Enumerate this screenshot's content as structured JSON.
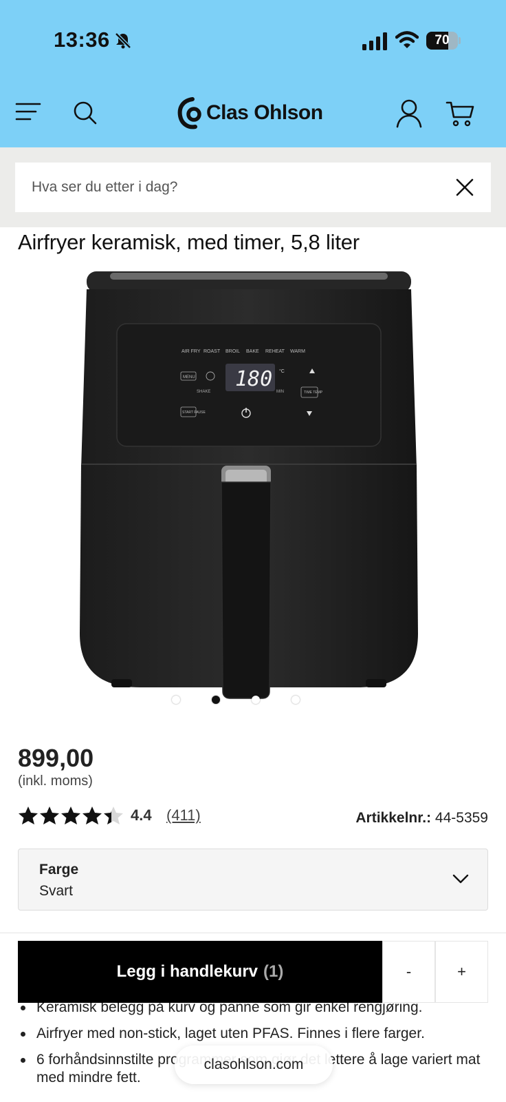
{
  "status_bar": {
    "time": "13:36",
    "battery": "70"
  },
  "header": {
    "brand": "Clas Ohlson"
  },
  "search": {
    "placeholder": "Hva ser du etter i dag?"
  },
  "product": {
    "title": "Airfryer keramisk, med timer, 5,8 liter",
    "display": {
      "modes": [
        "AIR FRY",
        "ROAST",
        "BROIL",
        "BAKE",
        "REHEAT",
        "WARM"
      ],
      "temperature": "180",
      "unit": "°C",
      "min": "MIN",
      "menu": "MENU",
      "shake": "SHAKE",
      "time_temp": "TIME TEMP",
      "start_pause": "START PAUSE"
    },
    "image_dots": 4,
    "active_dot": 1,
    "price": "899,00",
    "vat_note": "(inkl. moms)",
    "rating": {
      "value": 4.4,
      "value_text": "4.4",
      "count": "(411)"
    },
    "article_label": "Artikkelnr.:",
    "article_number": "44-5359",
    "color_select": {
      "label": "Farge",
      "value": "Svart"
    }
  },
  "cart_bar": {
    "add_label": "Legg i handlekurv",
    "quantity": "(1)",
    "minus": "-",
    "plus": "+"
  },
  "bullets": [
    "Keramisk belegg på kurv og panne som gir enkel rengjøring.",
    "Airfryer med non-stick, laget uten PFAS. Finnes i flere farger.",
    "6 forhåndsinnstilte programmer som gjør det lettere å lage variert mat med mindre fett."
  ],
  "browser": {
    "url": "clasohlson.com"
  },
  "colors": {
    "header_bg": "#7dd0f7",
    "search_band": "#ececea",
    "button_bg": "#000000",
    "star": "#111111"
  }
}
